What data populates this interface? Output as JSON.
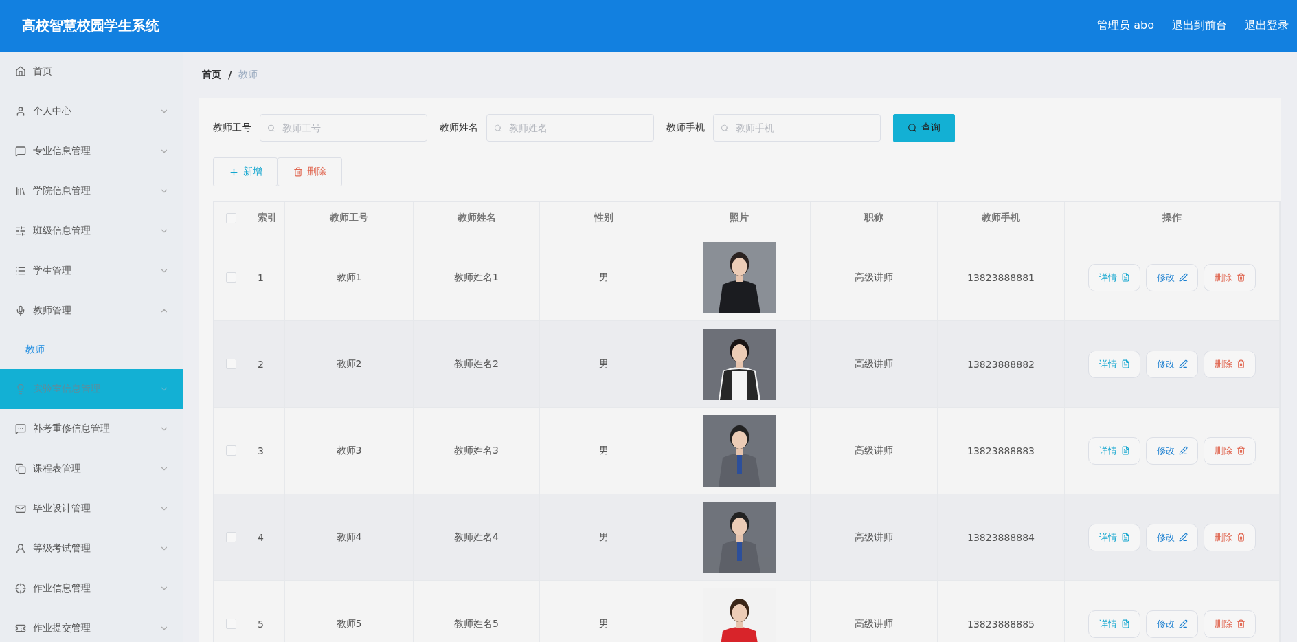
{
  "header": {
    "title": "高校智慧校园学生系统",
    "user": "管理员 abo",
    "links": [
      "退出到前台",
      "退出登录"
    ]
  },
  "sidebar": {
    "items": [
      {
        "label": "首页",
        "kind": "link",
        "hovered": false
      },
      {
        "label": "个人中心",
        "kind": "submenu",
        "expanded": false,
        "hovered": false
      },
      {
        "label": "专业信息管理",
        "kind": "submenu",
        "expanded": false,
        "hovered": false
      },
      {
        "label": "学院信息管理",
        "kind": "submenu",
        "expanded": false,
        "hovered": false
      },
      {
        "label": "班级信息管理",
        "kind": "submenu",
        "expanded": false,
        "hovered": false
      },
      {
        "label": "学生管理",
        "kind": "submenu",
        "expanded": false,
        "hovered": false
      },
      {
        "label": "教师管理",
        "kind": "submenu",
        "expanded": true,
        "hovered": false,
        "children": [
          {
            "label": "教师",
            "selected": true
          }
        ]
      },
      {
        "label": "实验室信息管理",
        "kind": "submenu",
        "expanded": false,
        "hovered": true
      },
      {
        "label": "补考重修信息管理",
        "kind": "submenu",
        "expanded": false,
        "hovered": false
      },
      {
        "label": "课程表管理",
        "kind": "submenu",
        "expanded": false,
        "hovered": false
      },
      {
        "label": "毕业设计管理",
        "kind": "submenu",
        "expanded": false,
        "hovered": false
      },
      {
        "label": "等级考试管理",
        "kind": "submenu",
        "expanded": false,
        "hovered": false
      },
      {
        "label": "作业信息管理",
        "kind": "submenu",
        "expanded": false,
        "hovered": false
      },
      {
        "label": "作业提交管理",
        "kind": "submenu",
        "expanded": false,
        "hovered": false
      }
    ]
  },
  "breadcrumb": [
    {
      "label": "首页",
      "current": false
    },
    {
      "label": "教师",
      "current": true
    }
  ],
  "breadcrumb_separator": "/",
  "search": {
    "fields": [
      {
        "label": "教师工号",
        "placeholder": "教师工号"
      },
      {
        "label": "教师姓名",
        "placeholder": "教师姓名"
      },
      {
        "label": "教师手机",
        "placeholder": "教师手机"
      }
    ],
    "button": "查询"
  },
  "actions": [
    {
      "label": "新增",
      "kind": "add"
    },
    {
      "label": "删除",
      "kind": "delete"
    }
  ],
  "table": {
    "select_all_checked": false,
    "columns": [
      "索引",
      "教师工号",
      "教师姓名",
      "性别",
      "照片",
      "职称",
      "教师手机",
      "操作"
    ],
    "rows": [
      {
        "checked": false,
        "index": "1",
        "id": "教师1",
        "name": "教师姓名1",
        "gender": "男",
        "title": "高级讲师",
        "phone": "13823888881",
        "actions": [
          {
            "label": "详情",
            "kind": "detail"
          },
          {
            "label": "修改",
            "kind": "edit"
          },
          {
            "label": "删除",
            "kind": "delete"
          }
        ]
      },
      {
        "checked": false,
        "index": "2",
        "id": "教师2",
        "name": "教师姓名2",
        "gender": "男",
        "title": "高级讲师",
        "phone": "13823888882",
        "actions": [
          {
            "label": "详情",
            "kind": "detail"
          },
          {
            "label": "修改",
            "kind": "edit"
          },
          {
            "label": "删除",
            "kind": "delete"
          }
        ]
      },
      {
        "checked": false,
        "index": "3",
        "id": "教师3",
        "name": "教师姓名3",
        "gender": "男",
        "title": "高级讲师",
        "phone": "13823888883",
        "actions": [
          {
            "label": "详情",
            "kind": "detail"
          },
          {
            "label": "修改",
            "kind": "edit"
          },
          {
            "label": "删除",
            "kind": "delete"
          }
        ]
      },
      {
        "checked": false,
        "index": "4",
        "id": "教师4",
        "name": "教师姓名4",
        "gender": "男",
        "title": "高级讲师",
        "phone": "13823888884",
        "actions": [
          {
            "label": "详情",
            "kind": "detail"
          },
          {
            "label": "修改",
            "kind": "edit"
          },
          {
            "label": "删除",
            "kind": "delete"
          }
        ]
      },
      {
        "checked": false,
        "index": "5",
        "id": "教师5",
        "name": "教师姓名5",
        "gender": "男",
        "title": "高级讲师",
        "phone": "13823888885",
        "actions": [
          {
            "label": "详情",
            "kind": "detail"
          },
          {
            "label": "修改",
            "kind": "edit"
          },
          {
            "label": "删除",
            "kind": "delete"
          }
        ]
      }
    ]
  }
}
